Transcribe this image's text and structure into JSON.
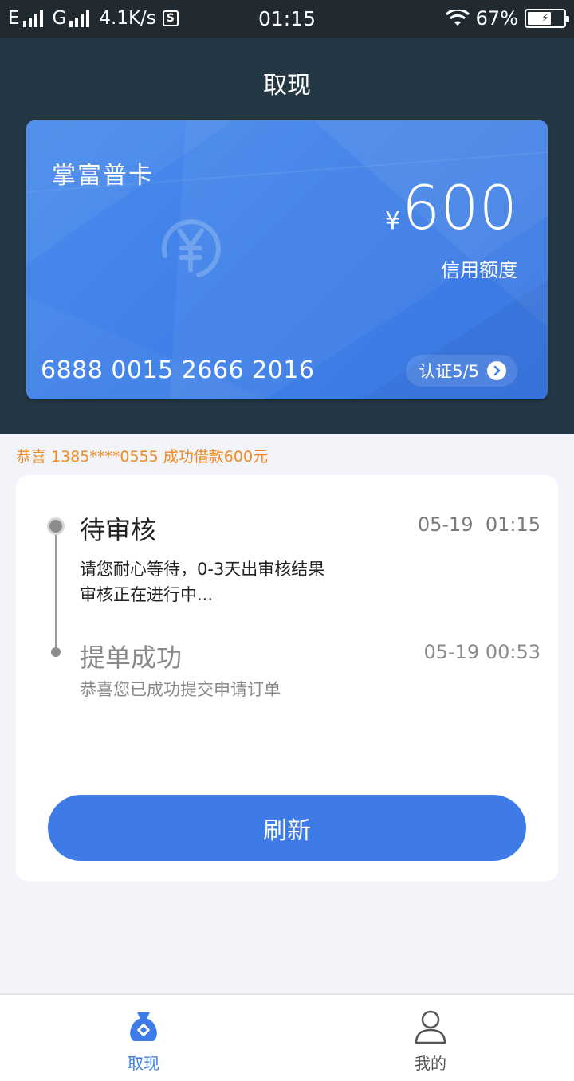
{
  "status_bar": {
    "network1": "E",
    "network2": "G",
    "speed": "4.1K/s",
    "s_badge": "S",
    "time": "01:15",
    "battery_pct": "67%",
    "battery_level": 0.67
  },
  "header": {
    "title": "取现"
  },
  "card": {
    "name": "掌富普卡",
    "currency_symbol": "¥",
    "amount": "600",
    "amount_label": "信用额度",
    "number": "6888 0015 2666 2016",
    "verify_label": "认证5/5"
  },
  "notice": {
    "text": "恭喜 1385****0555 成功借款600元"
  },
  "timeline": {
    "steps": [
      {
        "title": "待审核",
        "time": "05-19  01:15",
        "desc": [
          "请您耐心等待，0-3天出审核结果",
          "审核正在进行中..."
        ]
      },
      {
        "title": "提单成功",
        "time": "05-19 00:53",
        "desc": [
          "恭喜您已成功提交申请订单"
        ]
      }
    ]
  },
  "actions": {
    "refresh_label": "刷新"
  },
  "bottom_nav": {
    "items": [
      {
        "label": "取现",
        "icon": "money-bag-icon",
        "active": true
      },
      {
        "label": "我的",
        "icon": "user-icon",
        "active": false
      }
    ]
  },
  "colors": {
    "primary": "#3f7be6",
    "header_bg": "#233744",
    "notice": "#f08a1f"
  }
}
